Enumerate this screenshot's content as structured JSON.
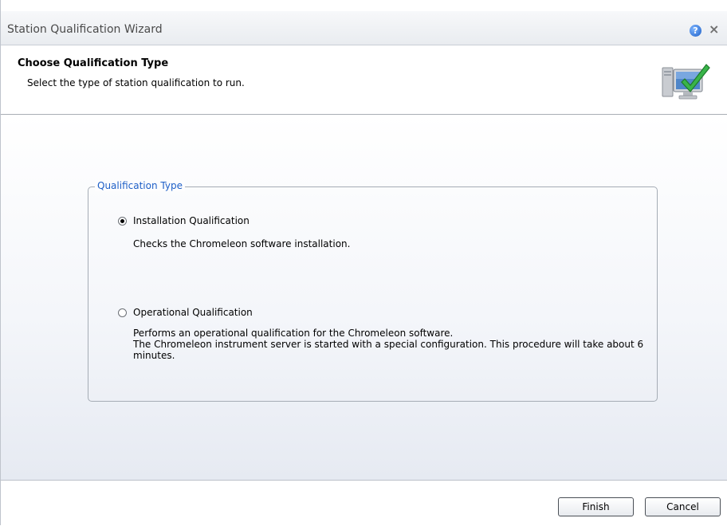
{
  "window": {
    "title": "Station Qualification Wizard",
    "help_glyph": "?",
    "close_glyph": "×"
  },
  "header": {
    "title": "Choose Qualification Type",
    "subtitle": "Select the type of station qualification to run.",
    "icon": "computer-check-icon"
  },
  "qualification": {
    "group_label": "Qualification Type",
    "options": [
      {
        "label": "Installation Qualification",
        "selected": true,
        "description_lines": [
          "Checks the Chromeleon software installation."
        ]
      },
      {
        "label": "Operational Qualification",
        "selected": false,
        "description_lines": [
          "Performs an operational qualification for the Chromeleon software.",
          "The Chromeleon instrument server is started with a special configuration. This procedure will take about 6",
          "minutes."
        ]
      }
    ]
  },
  "footer": {
    "finish_label": "Finish",
    "cancel_label": "Cancel"
  },
  "colors": {
    "accent": "#1e5fc7",
    "check_green": "#39b54a"
  }
}
